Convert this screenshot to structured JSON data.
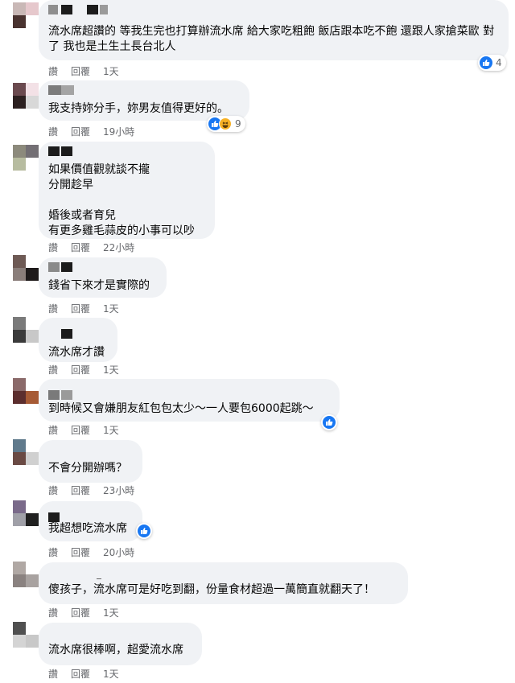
{
  "actions": {
    "like": "讚",
    "reply": "回覆"
  },
  "comments": [
    {
      "text": "流水席超讚的 等我生完也打算辦流水席 給大家吃粗飽 飯店跟本吃不飽 還跟人家搶菜歐 對了 我也是土生土長台北人",
      "time": "1天",
      "reaction_count": "4",
      "reactions": [
        "like-icon"
      ]
    },
    {
      "text": "我支持妳分手，妳男友值得更好的。",
      "time": "19小時",
      "reaction_count": "9",
      "reactions": [
        "like-icon",
        "haha-icon"
      ]
    },
    {
      "text": "如果價值觀就談不攏\n分開趁早\n\n婚後或者育兒\n有更多雞毛蒜皮的小事可以吵",
      "time": "22小時"
    },
    {
      "text": "錢省下來才是實際的",
      "time": "1天"
    },
    {
      "text": "流水席才讚",
      "time": "1天"
    },
    {
      "text": "到時候又會嫌朋友紅包包太少～一人要包6000起跳～",
      "time": "1天",
      "reactions": [
        "like-icon"
      ]
    },
    {
      "text": "不會分開辦嗎？",
      "time": "23小時"
    },
    {
      "text": "我超想吃流水席",
      "time": "20小時",
      "reactions": [
        "like-icon"
      ]
    },
    {
      "text": "傻孩子，流水席可是好吃到翻，份量食材超過一萬簡直就翻天了！",
      "time": "1天"
    },
    {
      "text": "流水席很棒啊，超愛流水席",
      "time": "1天"
    }
  ]
}
